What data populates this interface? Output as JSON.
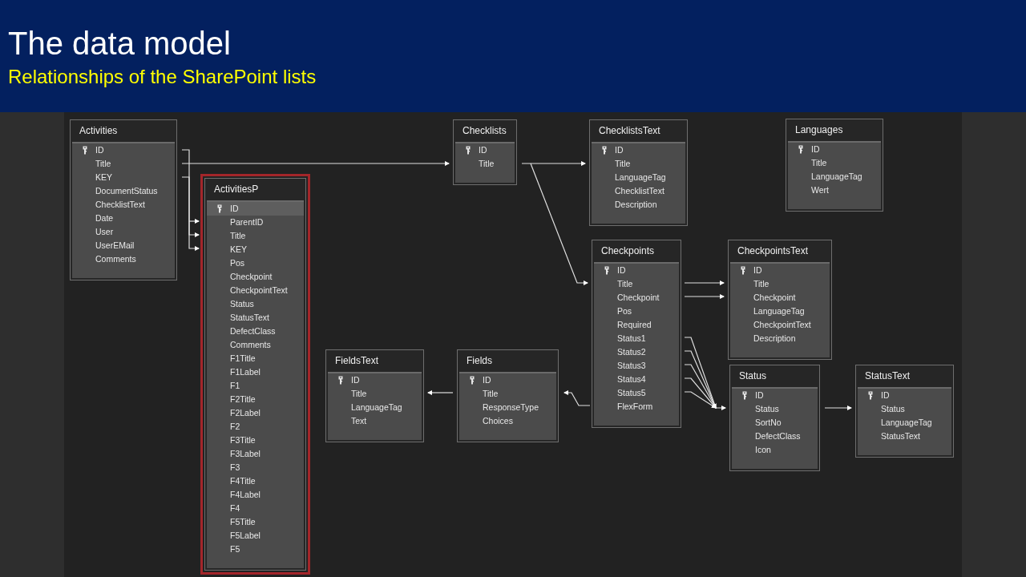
{
  "slide": {
    "title": "The data model",
    "subtitle": "Relationships of the SharePoint lists"
  },
  "tables": [
    {
      "name": "Activities",
      "selected": false,
      "columns": [
        {
          "name": "ID",
          "key": true,
          "selected": false
        },
        {
          "name": "Title",
          "key": false,
          "selected": false
        },
        {
          "name": "KEY",
          "key": false,
          "selected": false
        },
        {
          "name": "DocumentStatus",
          "key": false,
          "selected": false
        },
        {
          "name": "ChecklistText",
          "key": false,
          "selected": false
        },
        {
          "name": "Date",
          "key": false,
          "selected": false
        },
        {
          "name": "User",
          "key": false,
          "selected": false
        },
        {
          "name": "UserEMail",
          "key": false,
          "selected": false
        },
        {
          "name": "Comments",
          "key": false,
          "selected": false
        }
      ]
    },
    {
      "name": "ActivitiesP",
      "selected": true,
      "columns": [
        {
          "name": "ID",
          "key": true,
          "selected": true
        },
        {
          "name": "ParentID",
          "key": false,
          "selected": false
        },
        {
          "name": "Title",
          "key": false,
          "selected": false
        },
        {
          "name": "KEY",
          "key": false,
          "selected": false
        },
        {
          "name": "Pos",
          "key": false,
          "selected": false
        },
        {
          "name": "Checkpoint",
          "key": false,
          "selected": false
        },
        {
          "name": "CheckpointText",
          "key": false,
          "selected": false
        },
        {
          "name": "Status",
          "key": false,
          "selected": false
        },
        {
          "name": "StatusText",
          "key": false,
          "selected": false
        },
        {
          "name": "DefectClass",
          "key": false,
          "selected": false
        },
        {
          "name": "Comments",
          "key": false,
          "selected": false
        },
        {
          "name": "F1Title",
          "key": false,
          "selected": false
        },
        {
          "name": "F1Label",
          "key": false,
          "selected": false
        },
        {
          "name": "F1",
          "key": false,
          "selected": false
        },
        {
          "name": "F2Title",
          "key": false,
          "selected": false
        },
        {
          "name": "F2Label",
          "key": false,
          "selected": false
        },
        {
          "name": "F2",
          "key": false,
          "selected": false
        },
        {
          "name": "F3Title",
          "key": false,
          "selected": false
        },
        {
          "name": "F3Label",
          "key": false,
          "selected": false
        },
        {
          "name": "F3",
          "key": false,
          "selected": false
        },
        {
          "name": "F4Title",
          "key": false,
          "selected": false
        },
        {
          "name": "F4Label",
          "key": false,
          "selected": false
        },
        {
          "name": "F4",
          "key": false,
          "selected": false
        },
        {
          "name": "F5Title",
          "key": false,
          "selected": false
        },
        {
          "name": "F5Label",
          "key": false,
          "selected": false
        },
        {
          "name": "F5",
          "key": false,
          "selected": false
        }
      ]
    },
    {
      "name": "Checklists",
      "selected": false,
      "columns": [
        {
          "name": "ID",
          "key": true,
          "selected": false
        },
        {
          "name": "Title",
          "key": false,
          "selected": false
        }
      ]
    },
    {
      "name": "ChecklistsText",
      "selected": false,
      "columns": [
        {
          "name": "ID",
          "key": true,
          "selected": false
        },
        {
          "name": "Title",
          "key": false,
          "selected": false
        },
        {
          "name": "LanguageTag",
          "key": false,
          "selected": false
        },
        {
          "name": "ChecklistText",
          "key": false,
          "selected": false
        },
        {
          "name": "Description",
          "key": false,
          "selected": false
        }
      ]
    },
    {
      "name": "Languages",
      "selected": false,
      "columns": [
        {
          "name": "ID",
          "key": true,
          "selected": false
        },
        {
          "name": "Title",
          "key": false,
          "selected": false
        },
        {
          "name": "LanguageTag",
          "key": false,
          "selected": false
        },
        {
          "name": "Wert",
          "key": false,
          "selected": false
        }
      ]
    },
    {
      "name": "Checkpoints",
      "selected": false,
      "columns": [
        {
          "name": "ID",
          "key": true,
          "selected": false
        },
        {
          "name": "Title",
          "key": false,
          "selected": false
        },
        {
          "name": "Checkpoint",
          "key": false,
          "selected": false
        },
        {
          "name": "Pos",
          "key": false,
          "selected": false
        },
        {
          "name": "Required",
          "key": false,
          "selected": false
        },
        {
          "name": "Status1",
          "key": false,
          "selected": false
        },
        {
          "name": "Status2",
          "key": false,
          "selected": false
        },
        {
          "name": "Status3",
          "key": false,
          "selected": false
        },
        {
          "name": "Status4",
          "key": false,
          "selected": false
        },
        {
          "name": "Status5",
          "key": false,
          "selected": false
        },
        {
          "name": "FlexForm",
          "key": false,
          "selected": false
        }
      ]
    },
    {
      "name": "CheckpointsText",
      "selected": false,
      "columns": [
        {
          "name": "ID",
          "key": true,
          "selected": false
        },
        {
          "name": "Title",
          "key": false,
          "selected": false
        },
        {
          "name": "Checkpoint",
          "key": false,
          "selected": false
        },
        {
          "name": "LanguageTag",
          "key": false,
          "selected": false
        },
        {
          "name": "CheckpointText",
          "key": false,
          "selected": false
        },
        {
          "name": "Description",
          "key": false,
          "selected": false
        }
      ]
    },
    {
      "name": "FieldsText",
      "selected": false,
      "columns": [
        {
          "name": "ID",
          "key": true,
          "selected": false
        },
        {
          "name": "Title",
          "key": false,
          "selected": false
        },
        {
          "name": "LanguageTag",
          "key": false,
          "selected": false
        },
        {
          "name": "Text",
          "key": false,
          "selected": false
        }
      ]
    },
    {
      "name": "Fields",
      "selected": false,
      "columns": [
        {
          "name": "ID",
          "key": true,
          "selected": false
        },
        {
          "name": "Title",
          "key": false,
          "selected": false
        },
        {
          "name": "ResponseType",
          "key": false,
          "selected": false
        },
        {
          "name": "Choices",
          "key": false,
          "selected": false
        }
      ]
    },
    {
      "name": "Status",
      "selected": false,
      "columns": [
        {
          "name": "ID",
          "key": true,
          "selected": false
        },
        {
          "name": "Status",
          "key": false,
          "selected": false
        },
        {
          "name": "SortNo",
          "key": false,
          "selected": false
        },
        {
          "name": "DefectClass",
          "key": false,
          "selected": false
        },
        {
          "name": "Icon",
          "key": false,
          "selected": false
        }
      ]
    },
    {
      "name": "StatusText",
      "selected": false,
      "columns": [
        {
          "name": "ID",
          "key": true,
          "selected": false
        },
        {
          "name": "Status",
          "key": false,
          "selected": false
        },
        {
          "name": "LanguageTag",
          "key": false,
          "selected": false
        },
        {
          "name": "StatusText",
          "key": false,
          "selected": false
        }
      ]
    }
  ]
}
